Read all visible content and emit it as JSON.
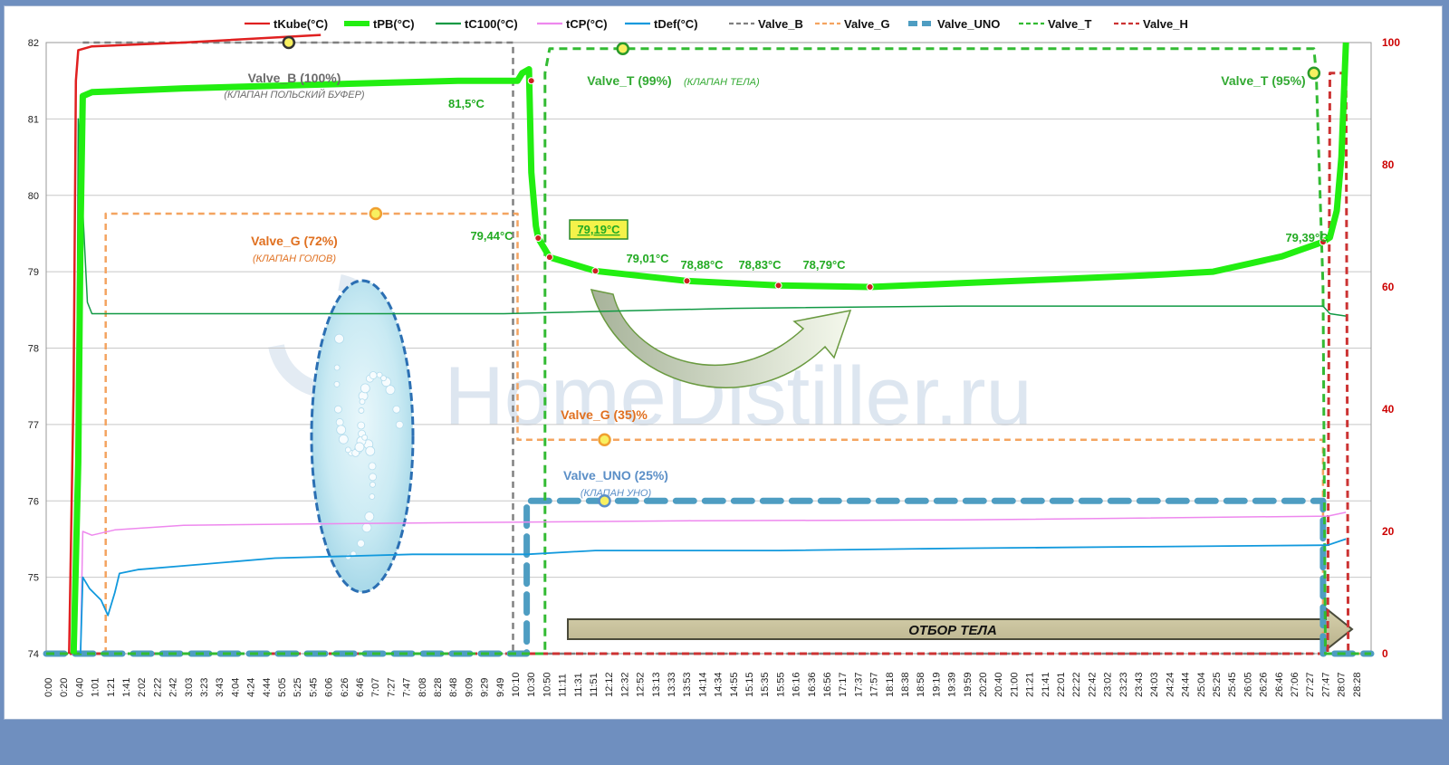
{
  "chart_data": {
    "type": "line",
    "title": "",
    "legend": {
      "position": "top",
      "entries": [
        {
          "name": "tKube(°C)",
          "color": "#e02020",
          "style": "solid"
        },
        {
          "name": "tPB(°C)",
          "color": "#22ee11",
          "style": "solid-thick"
        },
        {
          "name": "tC100(°C)",
          "color": "#119944",
          "style": "solid"
        },
        {
          "name": "tCP(°C)",
          "color": "#ee88ee",
          "style": "solid"
        },
        {
          "name": "tDef(°C)",
          "color": "#1199dd",
          "style": "solid"
        },
        {
          "name": "Valve_B",
          "color": "#808080",
          "style": "dashed"
        },
        {
          "name": "Valve_G",
          "color": "#f4a460",
          "style": "dashed"
        },
        {
          "name": "Valve_UNO",
          "color": "#4e9dc2",
          "style": "dashed-thick"
        },
        {
          "name": "Valve_T",
          "color": "#33bb33",
          "style": "dashed"
        },
        {
          "name": "Valve_H",
          "color": "#cc3333",
          "style": "dashed"
        }
      ]
    },
    "y_left": {
      "min": 74,
      "max": 82,
      "ticks": [
        "74",
        "75",
        "76",
        "77",
        "78",
        "79",
        "80",
        "81",
        "82"
      ]
    },
    "y_right": {
      "min": 0,
      "max": 100,
      "ticks": [
        "0",
        "20",
        "40",
        "60",
        "80",
        "100"
      ]
    },
    "x_ticks": [
      "0:00",
      "0:20",
      "0:40",
      "1:01",
      "1:21",
      "1:41",
      "2:02",
      "2:22",
      "2:42",
      "3:03",
      "3:23",
      "3:43",
      "4:04",
      "4:24",
      "4:44",
      "5:05",
      "5:25",
      "5:45",
      "6:06",
      "6:26",
      "6:46",
      "7:07",
      "7:27",
      "7:47",
      "8:08",
      "8:28",
      "8:48",
      "9:09",
      "9:29",
      "9:49",
      "10:10",
      "10:30",
      "10:50",
      "11:11",
      "11:31",
      "11:51",
      "12:12",
      "12:32",
      "12:52",
      "13:13",
      "13:33",
      "13:53",
      "14:14",
      "14:34",
      "14:55",
      "15:15",
      "15:35",
      "15:55",
      "16:16",
      "16:36",
      "16:56",
      "17:17",
      "17:37",
      "17:57",
      "18:18",
      "18:38",
      "18:58",
      "19:19",
      "19:39",
      "19:59",
      "20:20",
      "20:40",
      "21:00",
      "21:21",
      "21:41",
      "22:01",
      "22:22",
      "22:42",
      "23:02",
      "23:23",
      "23:43",
      "24:03",
      "24:24",
      "24:44",
      "25:04",
      "25:25",
      "25:45",
      "26:05",
      "26:26",
      "26:46",
      "27:06",
      "27:27",
      "27:47",
      "28:07",
      "28:28"
    ],
    "x_range_hours": [
      0,
      28.95
    ],
    "series": [
      {
        "name": "tPB(°C)",
        "axis": "left",
        "color": "#22ee11",
        "x": [
          0.6,
          0.7,
          0.75,
          0.8,
          1.0,
          3.0,
          6.0,
          9.0,
          10.3,
          10.4,
          10.55,
          10.6,
          10.7,
          10.75,
          11.0,
          12.0,
          14.0,
          16.0,
          18.0,
          20.0,
          22.0,
          24.0,
          25.5,
          27.0,
          27.9,
          28.05,
          28.2,
          28.3,
          28.4
        ],
        "y": [
          74.0,
          76.5,
          79.5,
          81.3,
          81.35,
          81.4,
          81.45,
          81.5,
          81.5,
          81.6,
          81.65,
          80.3,
          79.6,
          79.44,
          79.19,
          79.01,
          78.88,
          78.82,
          78.8,
          78.85,
          78.9,
          78.95,
          79.0,
          79.2,
          79.39,
          79.45,
          79.8,
          80.5,
          82.0
        ]
      },
      {
        "name": "tC100(°C)",
        "axis": "left",
        "color": "#119944",
        "x": [
          0.65,
          0.7,
          0.9,
          1.0,
          3.0,
          10.0,
          15.0,
          20.0,
          25.0,
          27.9,
          28.05,
          28.4
        ],
        "y": [
          74.0,
          81.0,
          78.6,
          78.45,
          78.45,
          78.45,
          78.52,
          78.55,
          78.55,
          78.55,
          78.45,
          78.42
        ]
      },
      {
        "name": "tCP(°C)",
        "axis": "left",
        "color": "#ee88ee",
        "x": [
          0.75,
          0.8,
          1.0,
          1.5,
          3.0,
          6.0,
          10.0,
          14.0,
          20.0,
          28.0,
          28.4
        ],
        "y": [
          74.0,
          75.6,
          75.55,
          75.62,
          75.68,
          75.7,
          75.72,
          75.74,
          75.75,
          75.8,
          75.85
        ]
      },
      {
        "name": "tDef(°C)",
        "axis": "left",
        "color": "#1199dd",
        "x": [
          0.75,
          0.8,
          0.95,
          1.2,
          1.35,
          1.5,
          1.6,
          2.0,
          3.0,
          5.0,
          8.0,
          10.5,
          12.0,
          16.0,
          20.0,
          24.0,
          28.0,
          28.4
        ],
        "y": [
          74.0,
          75.0,
          74.85,
          74.7,
          74.5,
          74.8,
          75.05,
          75.1,
          75.15,
          75.25,
          75.3,
          75.3,
          75.35,
          75.35,
          75.38,
          75.4,
          75.42,
          75.5
        ]
      },
      {
        "name": "tKube(°C)",
        "axis": "left",
        "color": "#e02020",
        "x": [
          0.5,
          0.6,
          0.65,
          0.7,
          1.0,
          3.0,
          6.0
        ],
        "y": [
          74.0,
          77.5,
          81.5,
          81.9,
          81.95,
          82.0,
          82.1
        ]
      },
      {
        "name": "Valve_B",
        "axis": "right",
        "color": "#808080",
        "x": [
          0.8,
          10.2,
          10.2,
          28.95
        ],
        "y": [
          100,
          100,
          0,
          0
        ]
      },
      {
        "name": "Valve_G",
        "axis": "right",
        "color": "#f4a460",
        "x": [
          1.3,
          1.3,
          10.3,
          10.3,
          27.9,
          27.9,
          28.95
        ],
        "y": [
          0,
          72,
          72,
          35,
          35,
          0,
          0
        ]
      },
      {
        "name": "Valve_UNO",
        "axis": "right",
        "color": "#4e9dc2",
        "x": [
          0.0,
          10.5,
          10.5,
          10.9,
          10.9,
          27.9,
          27.9,
          28.95
        ],
        "y": [
          0,
          0,
          25,
          25,
          25,
          25,
          0,
          0
        ]
      },
      {
        "name": "Valve_T",
        "axis": "right",
        "color": "#33bb33",
        "x": [
          0.0,
          10.9,
          10.9,
          11.0,
          27.7,
          27.75,
          27.9,
          27.95,
          28.95
        ],
        "y": [
          0,
          0,
          95,
          99,
          99,
          95,
          60,
          0,
          0
        ]
      },
      {
        "name": "Valve_H",
        "axis": "right",
        "color": "#cc3333",
        "x": [
          0.0,
          28.0,
          28.05,
          28.4,
          28.45,
          28.95
        ],
        "y": [
          0,
          0,
          95,
          95,
          0,
          0
        ]
      }
    ],
    "annotations": [
      {
        "id": "valve-b",
        "text": "Valve_B (100%)",
        "sub": "(КЛАПАН ПОЛЬСКИЙ БУФЕР)",
        "color": "#6b6b6b"
      },
      {
        "id": "valve-t-99",
        "text": "Valve_T (99%)",
        "sub": "(КЛАПАН ТЕЛА)",
        "color": "#33aa33"
      },
      {
        "id": "valve-t-95",
        "text": "Valve_T (95%)",
        "sub": "",
        "color": "#33aa33"
      },
      {
        "id": "valve-g-72",
        "text": "Valve_G (72%)",
        "sub": "(КЛАПАН ГОЛОВ)",
        "color": "#e07020"
      },
      {
        "id": "valve-g-35",
        "text": "Valve_G (35)%",
        "sub": "",
        "color": "#e07020"
      },
      {
        "id": "valve-uno",
        "text": "Valve_UNO (25%)",
        "sub": "(КЛАПАН УНО)",
        "color": "#5b8fc7"
      }
    ],
    "data_labels": [
      "81,5°C",
      "79,44°C",
      "79,19°C",
      "79,01°C",
      "78,88°C",
      "78,83°C",
      "78,79°C",
      "79,39°C"
    ],
    "arrow_label": "ОТБОР ТЕЛА",
    "watermark": "HomeDistiller.ru",
    "grid": true
  }
}
